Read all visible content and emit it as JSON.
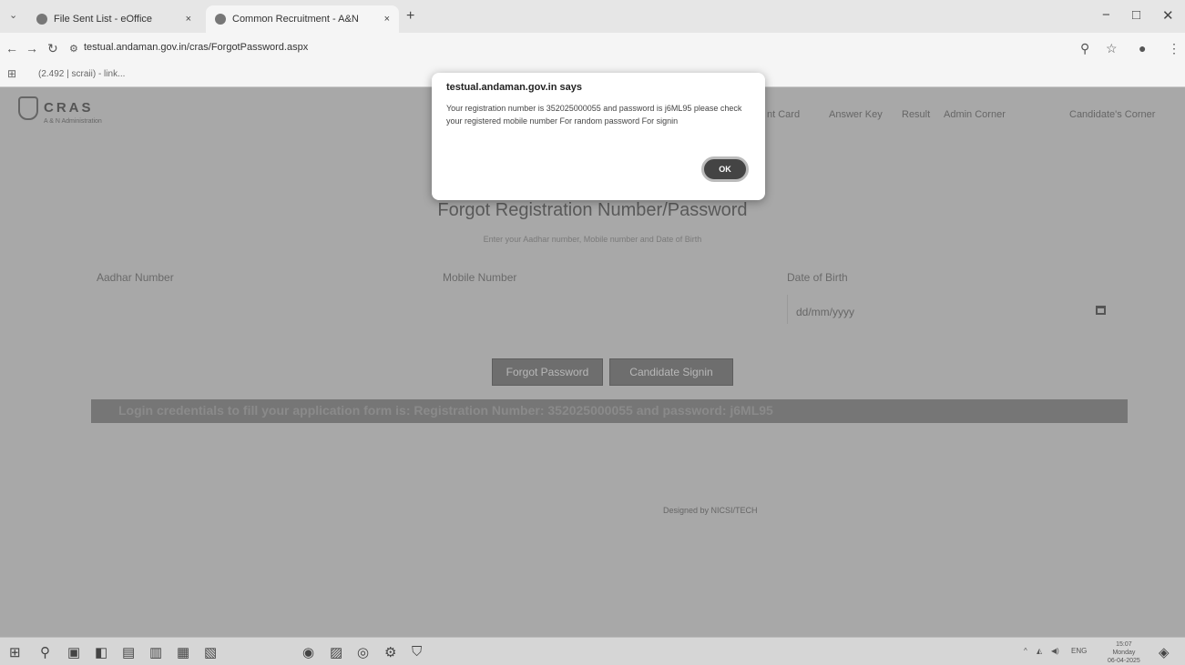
{
  "browser": {
    "tabs": [
      {
        "label": "File Sent List - eOffice",
        "close": "×"
      },
      {
        "label": "Common Recruitment - A&N",
        "close": "×"
      }
    ],
    "new_tab_glyph": "+",
    "url": "testual.andaman.gov.in/cras/ForgotPassword.aspx",
    "bookmark": "(2.492 | scraii) - link..."
  },
  "header": {
    "brand_name": "CRAS",
    "brand_sub": "A & N Administration",
    "nav": [
      "nt Card",
      "Answer Key",
      "Result",
      "Admin Corner",
      "Candidate's Corner"
    ]
  },
  "dialog": {
    "title": "testual.andaman.gov.in says",
    "message": "Your registration number is 352025000055 and password is j6ML95 please check your registered mobile number For random password For signin",
    "ok_label": "OK"
  },
  "form": {
    "title": "Forgot Registration Number/Password",
    "subtitle": "Enter your Aadhar number, Mobile number and Date of Birth",
    "aadhar_label": "Aadhar Number",
    "mobile_label": "Mobile Number",
    "dob_label": "Date of Birth",
    "dob_placeholder": "dd/mm/yyyy",
    "forgot_button": "Forgot Password",
    "signin_button": "Candidate Signin",
    "credentials": "Login credentials to fill your application form is: Registration Number: 352025000055 and password: j6ML95"
  },
  "footer": {
    "text": "Designed by NICSI/TECH"
  },
  "taskbar": {
    "lang": "ENG",
    "time": "15:07",
    "day": "Monday",
    "date": "06-04-2025"
  }
}
